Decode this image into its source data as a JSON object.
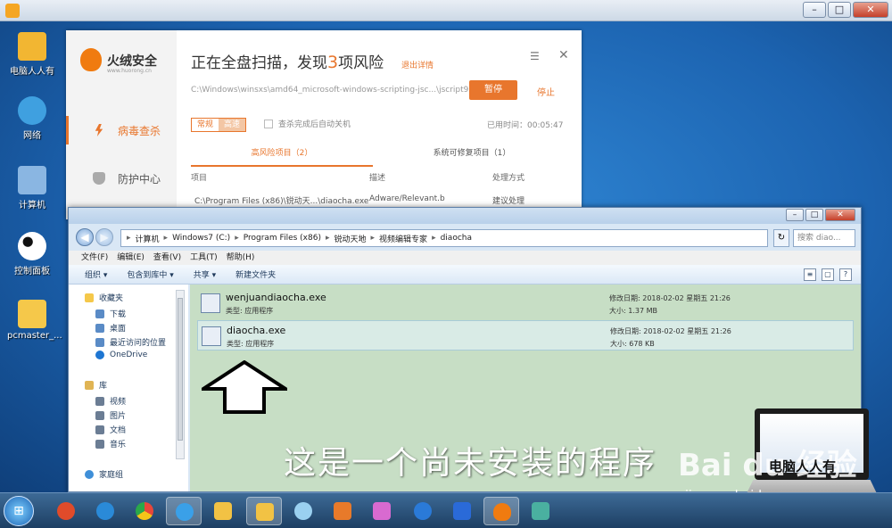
{
  "desktop": {
    "icons": [
      {
        "label": "电脑人人有",
        "color": "#f2b632"
      },
      {
        "label": "网络",
        "color": "#3fa0e0"
      },
      {
        "label": "计算机",
        "color": "#8ab6e2"
      },
      {
        "label": "控制面板",
        "color": "#ffffff"
      },
      {
        "label": "pcmaster_...",
        "color": "#f5c84a"
      }
    ]
  },
  "huorong": {
    "logo_text": "火绒安全",
    "logo_sub": "www.huorong.cn",
    "title_prefix": "正在全盘扫描，发现",
    "risk_count": "3",
    "title_suffix": "项风险",
    "detail_link": "退出详情",
    "scan_path": "C:\\Windows\\winsxs\\amd64_microsoft-windows-scripting-jsc...\\jscript9.dll",
    "pause_label": "暂停",
    "stop_label": "停止",
    "mode_normal": "常规",
    "mode_fast": "高速",
    "shutdown_label": "查杀完成后自动关机",
    "elapsed": "已用时间：00:05:47",
    "nav": [
      {
        "label": "病毒查杀"
      },
      {
        "label": "防护中心"
      }
    ],
    "tab_high": "高风险项目（2）",
    "tab_repair": "系统可修复项目（1）",
    "col_item": "项目",
    "col_desc": "描述",
    "col_action": "处理方式",
    "row1_item": "C:\\Program Files (x86)\\锐动天...\\diaocha.exe",
    "row1_desc": "Adware/Relevant.b",
    "row1_action": "建议处理"
  },
  "explorer": {
    "breadcrumb": [
      "计算机",
      "Windows7 (C:)",
      "Program Files (x86)",
      "锐动天地",
      "视频编辑专家",
      "diaocha"
    ],
    "search_placeholder": "搜索 diao...",
    "menu": [
      "文件(F)",
      "编辑(E)",
      "查看(V)",
      "工具(T)",
      "帮助(H)"
    ],
    "commands": [
      "组织 ▾",
      "包含到库中 ▾",
      "共享 ▾",
      "新建文件夹"
    ],
    "nav": [
      {
        "label": "收藏夹",
        "color": "#f5c84a"
      },
      {
        "label": "下载",
        "color": "#5a8bc6"
      },
      {
        "label": "桌面",
        "color": "#5a8bc6"
      },
      {
        "label": "最近访问的位置",
        "color": "#5a8bc6"
      },
      {
        "label": "OneDrive",
        "color": "#1e76d2"
      },
      {
        "label": "库",
        "color": "#e0b454"
      },
      {
        "label": "视频",
        "color": "#6b7d94"
      },
      {
        "label": "图片",
        "color": "#6b7d94"
      },
      {
        "label": "文档",
        "color": "#6b7d94"
      },
      {
        "label": "音乐",
        "color": "#6b7d94"
      },
      {
        "label": "家庭组",
        "color": "#3f8fd8"
      }
    ],
    "files": [
      {
        "name": "wenjuandiaocha.exe",
        "type": "类型: 应用程序",
        "date": "修改日期: 2018-02-02 星期五 21:26",
        "size": "大小: 1.37 MB"
      },
      {
        "name": "diaocha.exe",
        "type": "类型: 应用程序",
        "date": "修改日期: 2018-02-02 星期五 21:26",
        "size": "大小: 678 KB"
      }
    ]
  },
  "caption": "这是一个尚未安装的程序",
  "watermark": {
    "brand": "Bai du 经验",
    "url": "jingyan.baidu.com",
    "laptop_text": "电脑人人有"
  },
  "taskbar": {
    "items": [
      {
        "name": "huorong",
        "color": "#e04b2a"
      },
      {
        "name": "ie",
        "color": "#2a8ad8"
      },
      {
        "name": "chrome",
        "color": "#e8b03a"
      },
      {
        "name": "browser",
        "color": "#3aa0e8"
      },
      {
        "name": "folder",
        "color": "#f2c244"
      },
      {
        "name": "explorer",
        "color": "#f2c244"
      },
      {
        "name": "pinwheel",
        "color": "#9ad0f0"
      },
      {
        "name": "media",
        "color": "#e87a2a"
      },
      {
        "name": "paint",
        "color": "#d86ad0"
      },
      {
        "name": "film",
        "color": "#2a7ad8"
      },
      {
        "name": "store",
        "color": "#2a6ad8"
      },
      {
        "name": "fire",
        "color": "#f07b10"
      },
      {
        "name": "app",
        "color": "#4ab0a0"
      }
    ]
  }
}
